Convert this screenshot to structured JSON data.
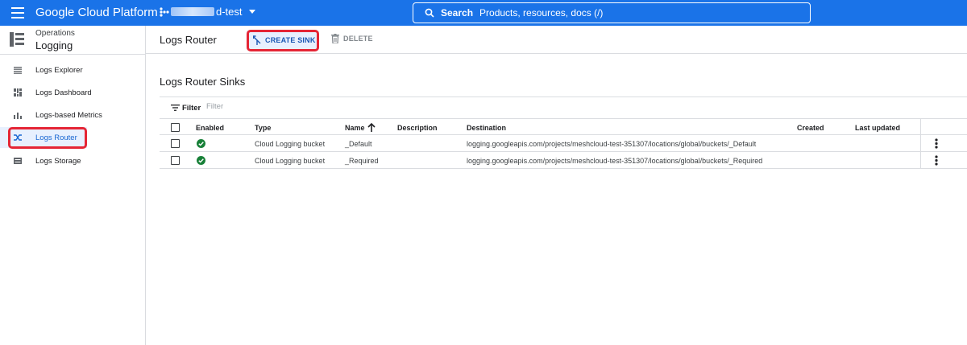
{
  "topbar": {
    "brand": "Google Cloud Platform",
    "project_suffix": "d-test",
    "search_label": "Search",
    "search_placeholder": "Products, resources, docs (/)"
  },
  "sidebar": {
    "product_parent": "Operations",
    "product_name": "Logging",
    "items": [
      {
        "label": "Logs Explorer",
        "icon": "list-icon"
      },
      {
        "label": "Logs Dashboard",
        "icon": "dashboard-icon"
      },
      {
        "label": "Logs-based Metrics",
        "icon": "bar-chart-icon"
      },
      {
        "label": "Logs Router",
        "icon": "shuffle-icon",
        "active": true
      },
      {
        "label": "Logs Storage",
        "icon": "storage-icon"
      }
    ]
  },
  "header": {
    "title": "Logs Router",
    "create_label": "CREATE SINK",
    "delete_label": "DELETE"
  },
  "section": {
    "title": "Logs Router Sinks",
    "filter_label": "Filter",
    "filter_placeholder": "Filter"
  },
  "table": {
    "columns": {
      "enabled": "Enabled",
      "type": "Type",
      "name": "Name",
      "description": "Description",
      "destination": "Destination",
      "created": "Created",
      "last_updated": "Last updated"
    },
    "rows": [
      {
        "type": "Cloud Logging bucket",
        "name": "_Default",
        "description": "",
        "destination": "logging.googleapis.com/projects/meshcloud-test-351307/locations/global/buckets/_Default",
        "created": "",
        "last_updated": ""
      },
      {
        "type": "Cloud Logging bucket",
        "name": "_Required",
        "description": "",
        "destination": "logging.googleapis.com/projects/meshcloud-test-351307/locations/global/buckets/_Required",
        "created": "",
        "last_updated": ""
      }
    ]
  },
  "colors": {
    "primary": "#1a73e8",
    "highlight": "#e52535",
    "active_bg": "#e8f0fe",
    "enabled_green": "#188038"
  }
}
